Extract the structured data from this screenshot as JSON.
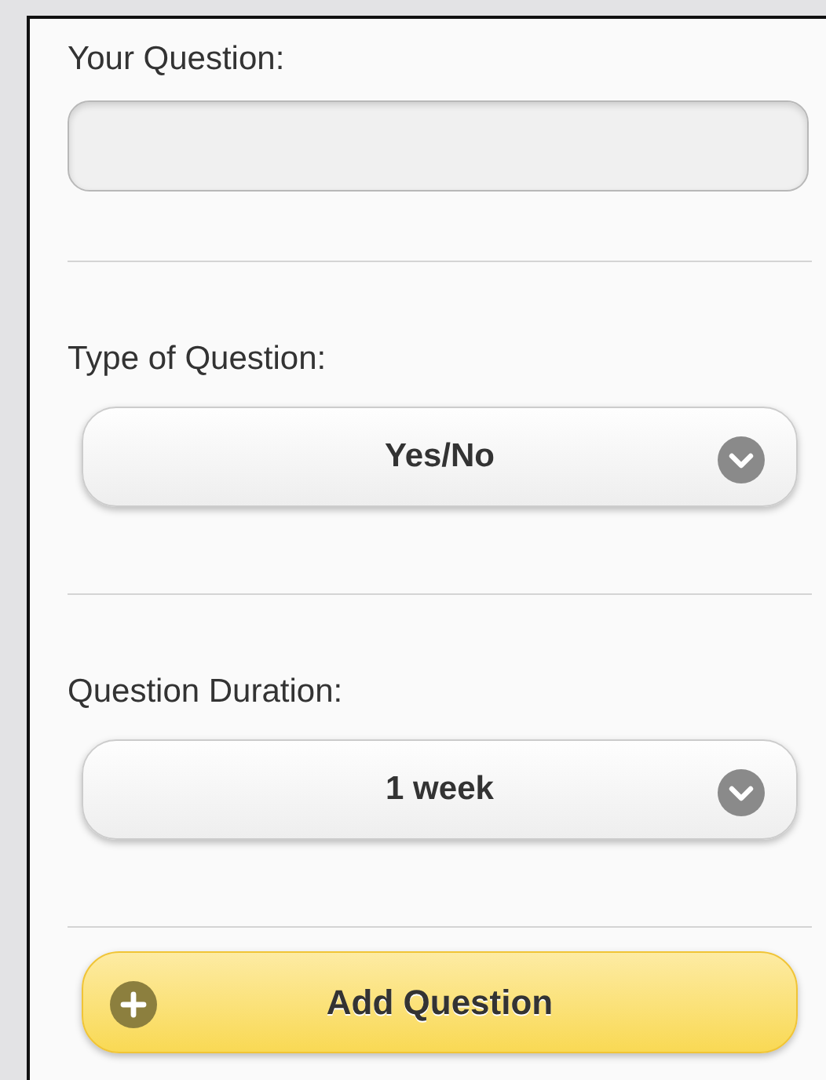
{
  "fields": [
    {
      "kind": "text",
      "label": "Your Question:"
    },
    {
      "kind": "select",
      "label": "Type of Question:",
      "value": "Yes/No"
    },
    {
      "kind": "select",
      "label": "Question Duration:",
      "value": "1 week"
    }
  ],
  "button": {
    "label": "Add Question"
  }
}
